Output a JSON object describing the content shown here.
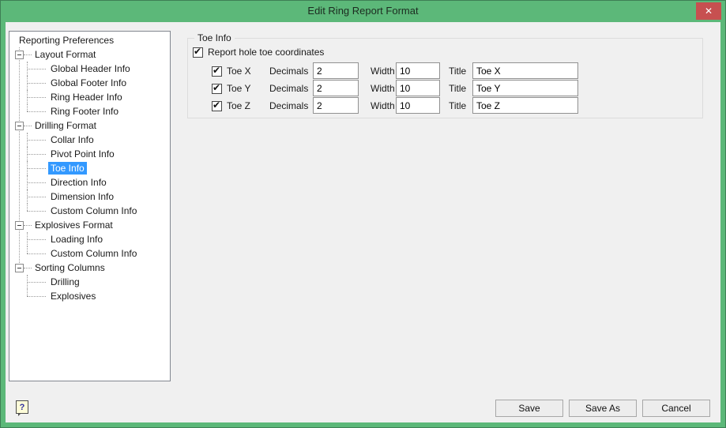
{
  "window": {
    "title": "Edit Ring Report Format"
  },
  "glyphs": {
    "close": "✕",
    "check": "✔",
    "help": "?"
  },
  "colors": {
    "titlebar_green": "#5cb879",
    "close_red": "#c75050",
    "selection_blue": "#3399ff",
    "body_gray": "#f0f0f0"
  },
  "tree": {
    "items": [
      {
        "label": "Reporting Preferences",
        "level": 0,
        "type": "root",
        "selected": false,
        "last": false
      },
      {
        "label": "Layout Format",
        "level": 1,
        "type": "branch",
        "selected": false,
        "last": false
      },
      {
        "label": "Global Header Info",
        "level": 2,
        "type": "leaf",
        "selected": false,
        "last": false
      },
      {
        "label": "Global Footer Info",
        "level": 2,
        "type": "leaf",
        "selected": false,
        "last": false
      },
      {
        "label": "Ring Header Info",
        "level": 2,
        "type": "leaf",
        "selected": false,
        "last": false
      },
      {
        "label": "Ring Footer Info",
        "level": 2,
        "type": "leaf",
        "selected": false,
        "last": true
      },
      {
        "label": "Drilling Format",
        "level": 1,
        "type": "branch",
        "selected": false,
        "last": false
      },
      {
        "label": "Collar Info",
        "level": 2,
        "type": "leaf",
        "selected": false,
        "last": false
      },
      {
        "label": "Pivot Point Info",
        "level": 2,
        "type": "leaf",
        "selected": false,
        "last": false
      },
      {
        "label": "Toe Info",
        "level": 2,
        "type": "leaf",
        "selected": true,
        "last": false
      },
      {
        "label": "Direction Info",
        "level": 2,
        "type": "leaf",
        "selected": false,
        "last": false
      },
      {
        "label": "Dimension Info",
        "level": 2,
        "type": "leaf",
        "selected": false,
        "last": false
      },
      {
        "label": "Custom Column Info",
        "level": 2,
        "type": "leaf",
        "selected": false,
        "last": true
      },
      {
        "label": "Explosives Format",
        "level": 1,
        "type": "branch",
        "selected": false,
        "last": false
      },
      {
        "label": "Loading Info",
        "level": 2,
        "type": "leaf",
        "selected": false,
        "last": false
      },
      {
        "label": "Custom Column Info",
        "level": 2,
        "type": "leaf",
        "selected": false,
        "last": true
      },
      {
        "label": "Sorting Columns",
        "level": 1,
        "type": "branch",
        "selected": false,
        "last": false
      },
      {
        "label": "Drilling",
        "level": 2,
        "type": "leaf",
        "selected": false,
        "last": false
      },
      {
        "label": "Explosives",
        "level": 2,
        "type": "leaf",
        "selected": false,
        "last": true
      }
    ]
  },
  "panel": {
    "group_title": "Toe Info",
    "master_checkbox": {
      "label": "Report hole toe coordinates",
      "checked": true
    },
    "labels": {
      "decimals": "Decimals",
      "width": "Width",
      "title": "Title"
    },
    "rows": [
      {
        "label": "Toe X",
        "checked": true,
        "decimals": "2",
        "width": "10",
        "title": "Toe X"
      },
      {
        "label": "Toe Y",
        "checked": true,
        "decimals": "2",
        "width": "10",
        "title": "Toe Y"
      },
      {
        "label": "Toe Z",
        "checked": true,
        "decimals": "2",
        "width": "10",
        "title": "Toe Z"
      }
    ]
  },
  "footer": {
    "buttons": [
      {
        "label": "Save"
      },
      {
        "label": "Save As"
      },
      {
        "label": "Cancel"
      }
    ]
  }
}
